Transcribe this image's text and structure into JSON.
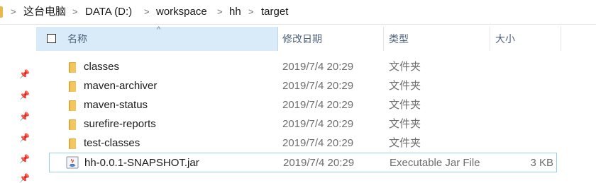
{
  "breadcrumb": {
    "items": [
      "这台电脑",
      "DATA (D:)",
      "workspace",
      "hh",
      "target"
    ],
    "separator": ">"
  },
  "columns": {
    "name": "名称",
    "date_modified": "修改日期",
    "type": "类型",
    "size": "大小"
  },
  "files": [
    {
      "name": "classes",
      "date": "2019/7/4 20:29",
      "type": "文件夹",
      "size": "",
      "icon": "folder-icon"
    },
    {
      "name": "maven-archiver",
      "date": "2019/7/4 20:29",
      "type": "文件夹",
      "size": "",
      "icon": "folder-icon"
    },
    {
      "name": "maven-status",
      "date": "2019/7/4 20:29",
      "type": "文件夹",
      "size": "",
      "icon": "folder-icon"
    },
    {
      "name": "surefire-reports",
      "date": "2019/7/4 20:29",
      "type": "文件夹",
      "size": "",
      "icon": "folder-icon"
    },
    {
      "name": "test-classes",
      "date": "2019/7/4 20:29",
      "type": "文件夹",
      "size": "",
      "icon": "folder-icon"
    },
    {
      "name": "hh-0.0.1-SNAPSHOT.jar",
      "date": "2019/7/4 20:29",
      "type": "Executable Jar File",
      "size": "3 KB",
      "icon": "jar-file-icon"
    }
  ],
  "colors": {
    "header_highlight": "#d9ebf9",
    "selection_border": "#9dcdf2",
    "folder": "#f3c75c",
    "secondary_text": "#6d6d6d"
  }
}
